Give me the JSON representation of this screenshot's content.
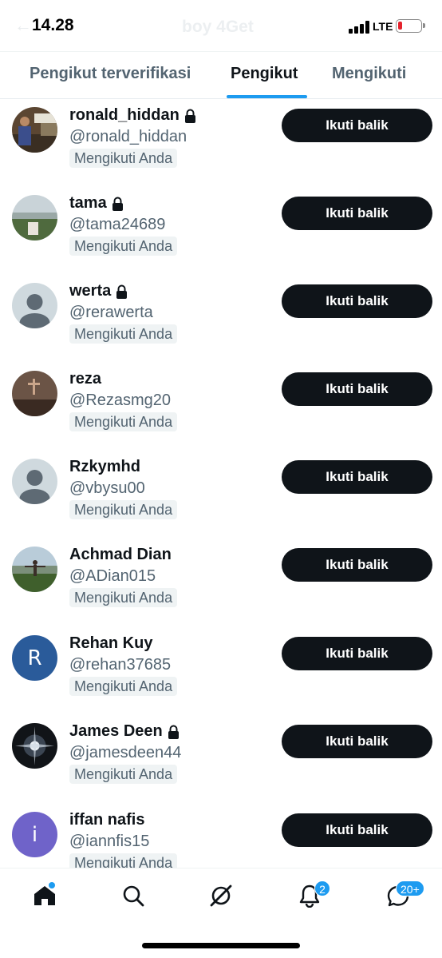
{
  "status_bar": {
    "time": "14.28",
    "network": "LTE",
    "ghost_title": "boy 4Get",
    "battery_level": 0.15,
    "battery_color": "#e5232d"
  },
  "tabs": [
    {
      "label": "Pengikut terverifikasi",
      "active": false
    },
    {
      "label": "Pengikut",
      "active": true
    },
    {
      "label": "Mengikuti",
      "active": false
    }
  ],
  "accent_color": "#1d9bf0",
  "followers": [
    {
      "name": "ronald_hiddan",
      "handle": "@ronald_hiddan",
      "badge": "Mengikuti Anda",
      "locked": true,
      "avatar": "photo-1",
      "button": "Ikuti balik"
    },
    {
      "name": "tama",
      "handle": "@tama24689",
      "badge": "Mengikuti Anda",
      "locked": true,
      "avatar": "photo-2",
      "button": "Ikuti balik"
    },
    {
      "name": "werta",
      "handle": "@rerawerta",
      "badge": "Mengikuti Anda",
      "locked": true,
      "avatar": "default-avatar",
      "button": "Ikuti balik"
    },
    {
      "name": "reza",
      "handle": "@Rezasmg20",
      "badge": "Mengikuti Anda",
      "locked": false,
      "avatar": "photo-3",
      "button": "Ikuti balik"
    },
    {
      "name": "Rzkymhd",
      "handle": "@vbysu00",
      "badge": "Mengikuti Anda",
      "locked": false,
      "avatar": "default-avatar",
      "button": "Ikuti balik"
    },
    {
      "name": "Achmad Dian",
      "handle": "@ADian015",
      "badge": "Mengikuti Anda",
      "locked": false,
      "avatar": "photo-4",
      "button": "Ikuti balik"
    },
    {
      "name": "Rehan Kuy",
      "handle": "@rehan37685",
      "badge": "Mengikuti Anda",
      "locked": false,
      "avatar": "letter",
      "avatar_letter": "R",
      "avatar_color": "#2a5b9a",
      "button": "Ikuti balik"
    },
    {
      "name": "James Deen",
      "handle": "@jamesdeen44",
      "badge": "Mengikuti Anda",
      "locked": true,
      "avatar": "photo-5",
      "button": "Ikuti balik"
    },
    {
      "name": "iffan nafis",
      "handle": "@iannfis15",
      "badge": "Mengikuti Anda",
      "locked": false,
      "avatar": "letter",
      "avatar_letter": "i",
      "avatar_color": "#6f63c9",
      "button": "Ikuti balik"
    }
  ],
  "bottom_nav": {
    "items": [
      "home-icon",
      "search-icon",
      "grok-icon",
      "notifications-icon",
      "messages-icon"
    ],
    "notifications_count": "2",
    "messages_count": "20+"
  }
}
